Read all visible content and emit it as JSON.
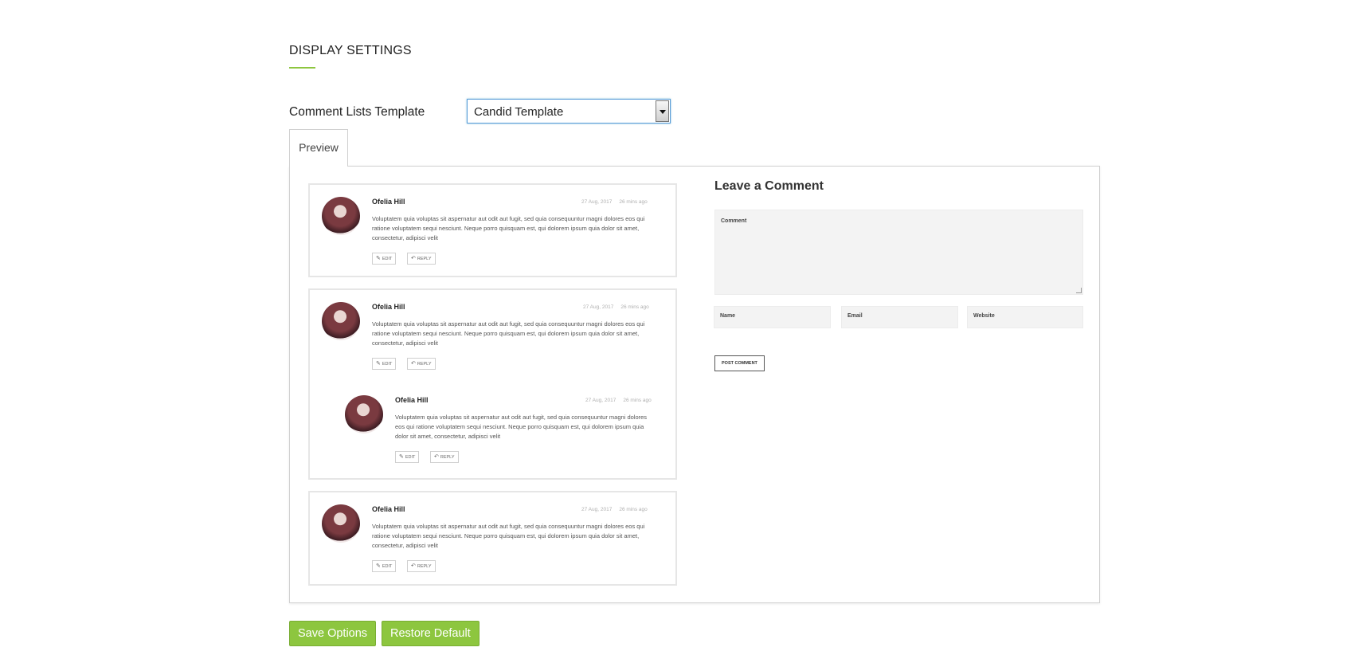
{
  "section": {
    "title": "DISPLAY SETTINGS"
  },
  "template_field": {
    "label": "Comment Lists Template",
    "selected": "Candid Template"
  },
  "tab": {
    "label": "Preview"
  },
  "comment": {
    "author": "Ofelia Hill",
    "date": "27 Aug, 2017",
    "ago": "26 mins ago",
    "text": "Voluptatem quia voluptas sit aspernatur aut odit aut fugit, sed quia consequuntur magni dolores eos qui ratione voluptatem sequi nesciunt. Neque porro quisquam est, qui dolorem ipsum quia dolor sit amet, consectetur, adipisci velit",
    "edit_label": "EDIT",
    "reply_label": "REPLY"
  },
  "form": {
    "heading": "Leave a Comment",
    "comment_label": "Comment",
    "name_label": "Name",
    "email_label": "Email",
    "website_label": "Website",
    "submit_label": "POST COMMENT"
  },
  "buttons": {
    "save": "Save Options",
    "restore": "Restore Default"
  },
  "colors": {
    "accent": "#8dc63f",
    "focus_border": "#5b9dd9",
    "panel_border": "#d0d0d0"
  },
  "icons": {
    "edit": "pencil-icon",
    "reply": "reply-icon",
    "dropdown": "chevron-down-icon"
  }
}
